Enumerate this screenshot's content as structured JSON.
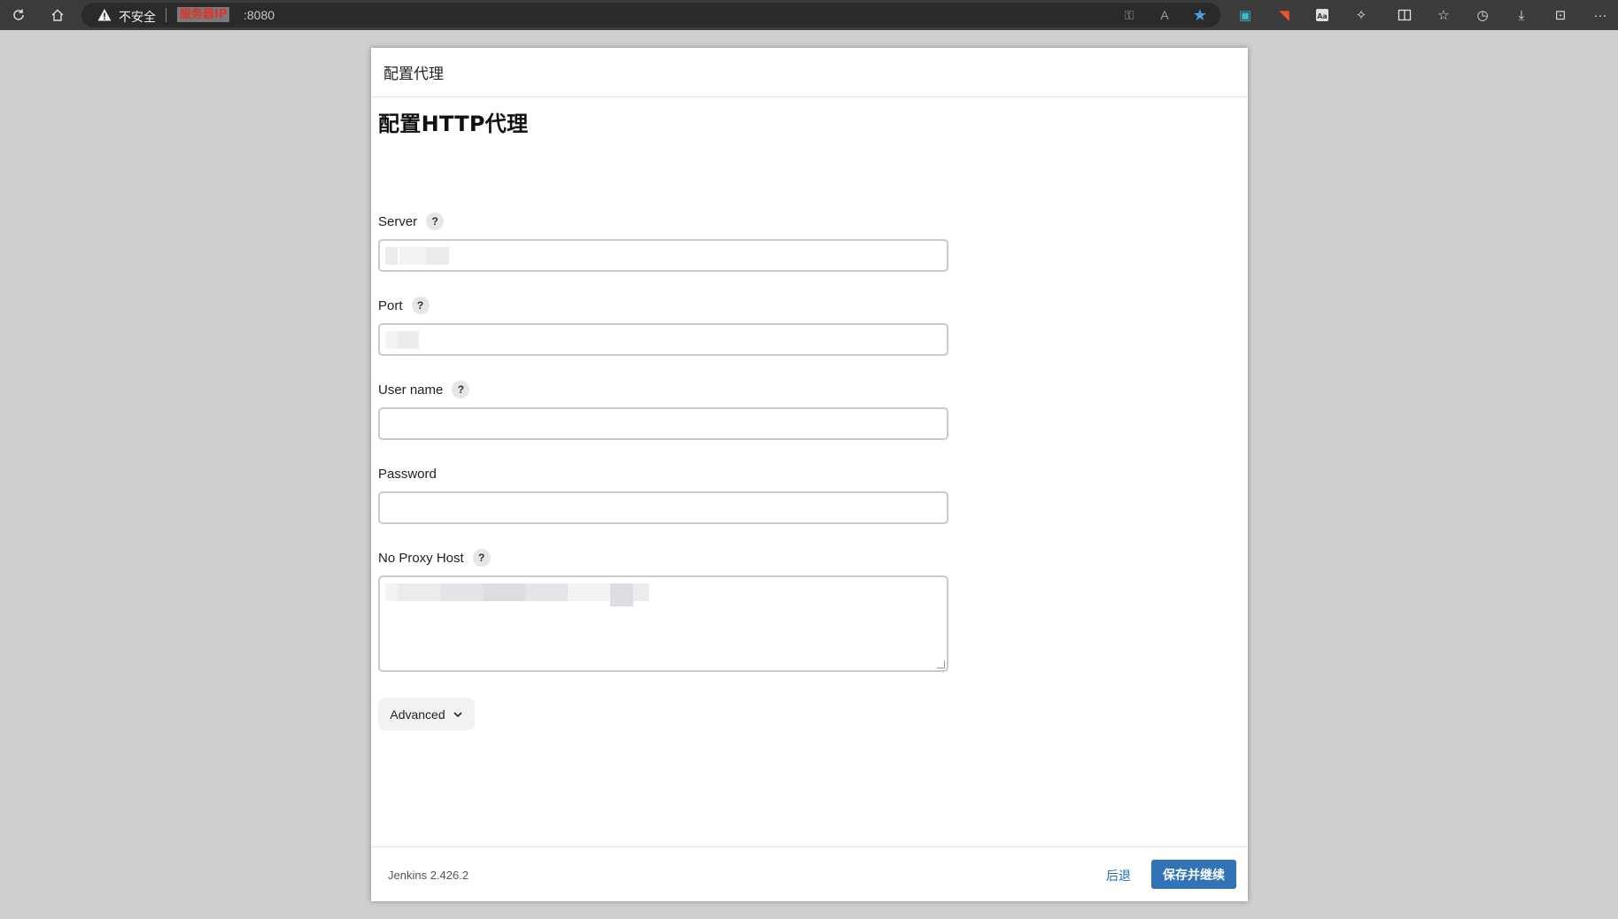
{
  "browser": {
    "security_label": "不安全",
    "host_redacted": "服务器IP",
    "port": ":8080"
  },
  "dialog": {
    "header": "配置代理",
    "form_title": "配置HTTP代理",
    "fields": [
      {
        "label": "Server",
        "has_help": true,
        "value": ""
      },
      {
        "label": "Port",
        "has_help": true,
        "value": ""
      },
      {
        "label": "User name",
        "has_help": true,
        "value": ""
      },
      {
        "label": "Password",
        "has_help": false,
        "value": ""
      },
      {
        "label": "No Proxy Host",
        "has_help": true,
        "value": ""
      }
    ],
    "help_glyph": "?",
    "advanced_label": "Advanced"
  },
  "footer": {
    "version": "Jenkins 2.426.2",
    "back_label": "后退",
    "save_label": "保存并继续"
  },
  "colors": {
    "primary_button": "#3173b5",
    "link": "#1f6fb7",
    "toolbar": "#3b3b3b"
  }
}
